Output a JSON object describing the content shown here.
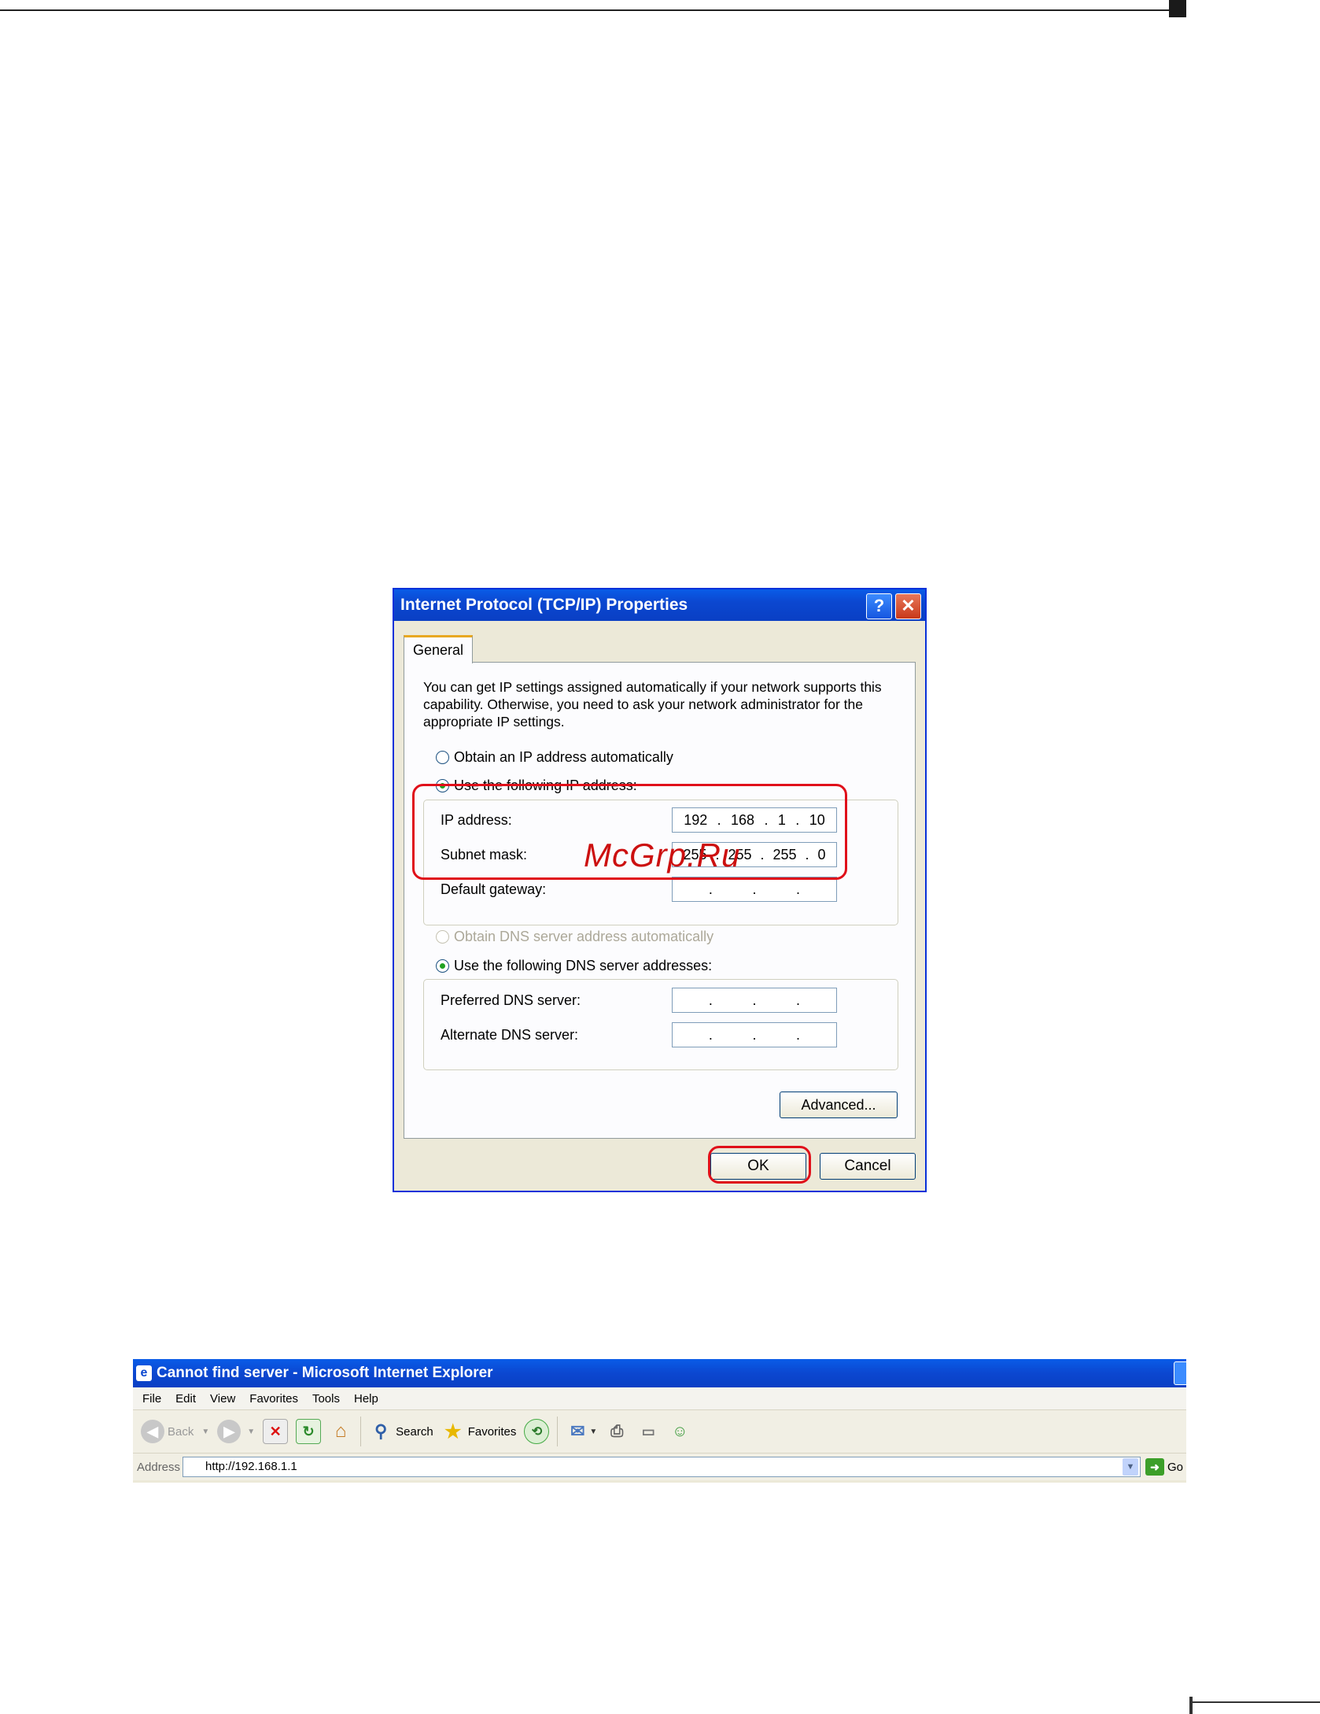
{
  "dialog": {
    "title": "Internet Protocol (TCP/IP) Properties",
    "help_glyph": "?",
    "close_glyph": "✕",
    "tab": "General",
    "intro": "You can get IP settings assigned automatically if your network supports this capability. Otherwise, you need to ask your network administrator for the appropriate IP settings.",
    "radio_auto_ip": "Obtain an IP address automatically",
    "radio_manual_ip": "Use the following IP address:",
    "ip_label": "IP address:",
    "ip_octets": [
      "192",
      "168",
      "1",
      "10"
    ],
    "subnet_label": "Subnet mask:",
    "subnet_octets": [
      "255",
      "255",
      "255",
      "0"
    ],
    "gateway_label": "Default gateway:",
    "radio_auto_dns": "Obtain DNS server address automatically",
    "radio_manual_dns": "Use the following DNS server addresses:",
    "preferred_dns_label": "Preferred DNS server:",
    "alternate_dns_label": "Alternate DNS server:",
    "advanced_button": "Advanced...",
    "ok_button": "OK",
    "cancel_button": "Cancel"
  },
  "watermark": "McGrp.Ru",
  "browser": {
    "title": "Cannot find server - Microsoft Internet Explorer",
    "menu": [
      "File",
      "Edit",
      "View",
      "Favorites",
      "Tools",
      "Help"
    ],
    "back_label": "Back",
    "search_label": "Search",
    "favorites_label": "Favorites",
    "address_label": "Address",
    "address_value": "http://192.168.1.1",
    "go_label": "Go"
  },
  "colors": {
    "highlight": "#e0101a",
    "titlebar": "#0b47d0",
    "dialog_bg": "#ece9d8"
  }
}
